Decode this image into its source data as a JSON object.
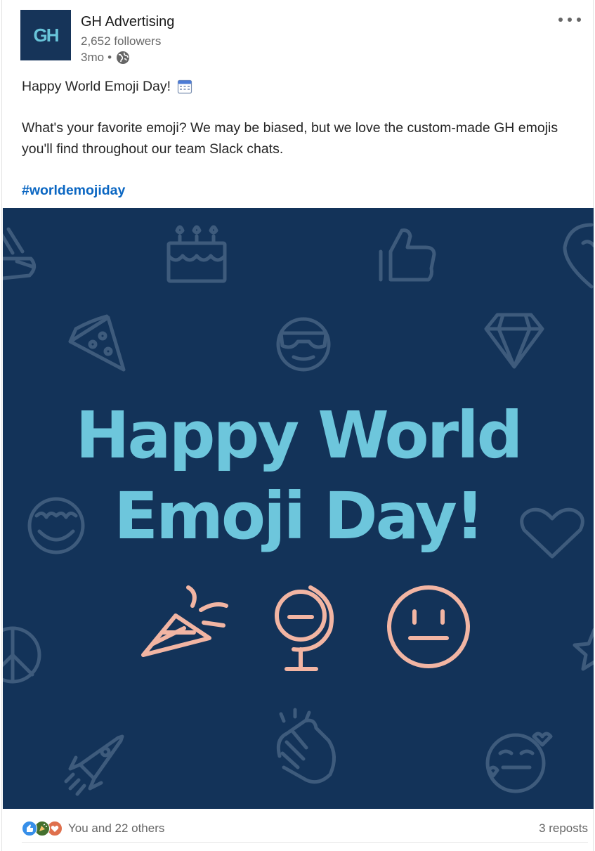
{
  "author": {
    "logo_text": "GH",
    "name": "GH Advertising",
    "followers": "2,652 followers",
    "time": "3mo",
    "separator": "•",
    "visibility_icon": "globe-icon"
  },
  "post": {
    "line1": "Happy World Emoji Day!",
    "line1_icon": "calendar-emoji-icon",
    "body": "What's your favorite emoji? We may be biased, but we love the custom-made GH emojis you'll find throughout our team Slack chats.",
    "hashtag": "#worldemojiday"
  },
  "image": {
    "headline_line1": "Happy World",
    "headline_line2": "Emoji Day!",
    "colors": {
      "background": "#133359",
      "headline": "#6dc6dc",
      "accent": "#f2b5a3",
      "muted_icons": "#3d5a7a"
    },
    "icons": [
      "victory-hand-icon",
      "birthday-cake-icon",
      "thumbs-up-icon",
      "heart-pin-icon",
      "pizza-icon",
      "sunglasses-face-icon",
      "diamond-icon",
      "heart-eyes-face-icon",
      "heart-icon",
      "party-popper-icon",
      "crystal-ball-icon",
      "smiley-face-icon",
      "peace-sign-icon",
      "star-icon",
      "rocket-icon",
      "clapping-hands-icon",
      "blushing-face-icon"
    ]
  },
  "footer": {
    "reactions_text": "You and 22 others",
    "reaction_icons": [
      "like-icon",
      "celebrate-icon",
      "love-icon"
    ],
    "reposts": "3 reposts"
  }
}
